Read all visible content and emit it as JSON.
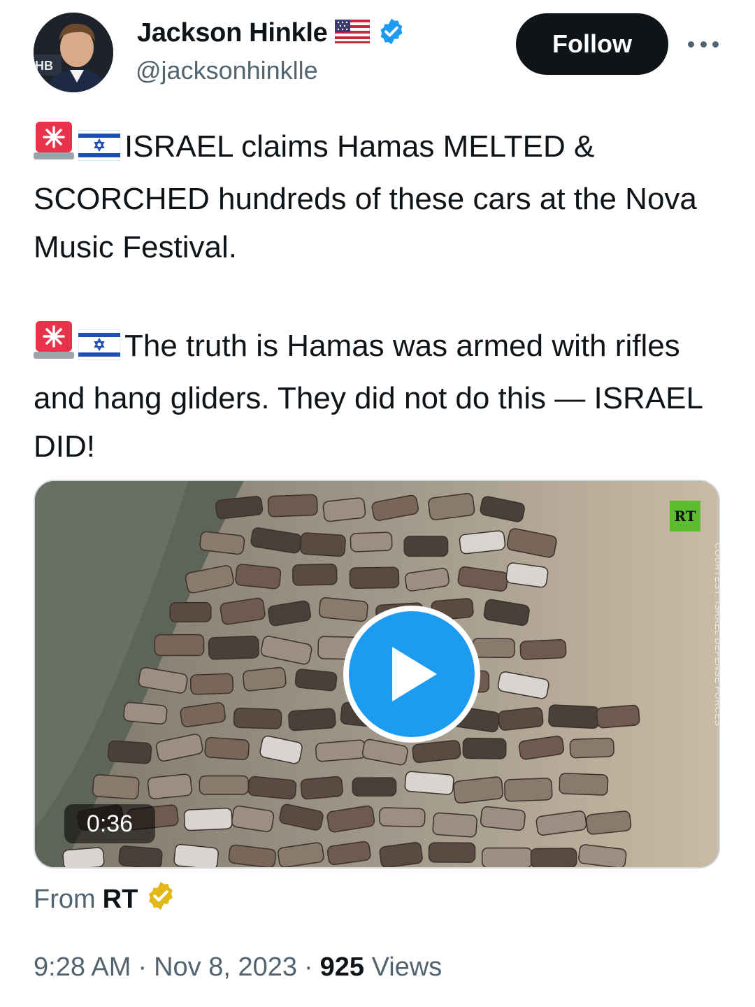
{
  "author": {
    "name": "Jackson Hinkle",
    "handle": "@jacksonhinklle",
    "flag_icon": "us-flag-icon",
    "verified_icon": "blue-verified-badge-icon"
  },
  "actions": {
    "follow_label": "Follow",
    "more_icon": "more-options-icon"
  },
  "tweet": {
    "paragraphs": [
      {
        "icons": [
          "police-light-icon",
          "israel-flag-icon"
        ],
        "text": "ISRAEL claims Hamas MELTED & SCORCHED hundreds of these cars  at the Nova Music Festival."
      },
      {
        "icons": [
          "police-light-icon",
          "israel-flag-icon"
        ],
        "text": "The truth is Hamas was armed with rifles and hang gliders. They did not do this — ISRAEL DID!"
      }
    ]
  },
  "media": {
    "duration": "0:36",
    "watermark_logo": "RT",
    "courtesy": "COURTESY: ISRAEL DEFENSE FORCES",
    "play_icon": "play-icon"
  },
  "source": {
    "prefix": "From",
    "name": "RT",
    "badge_icon": "gold-verified-badge-icon"
  },
  "meta": {
    "time": "9:28 AM",
    "separator": "·",
    "date": "Nov 8, 2023",
    "views_count": "925",
    "views_label": "Views"
  },
  "colors": {
    "accent": "#1d9bf0",
    "text": "#0f1419",
    "secondary": "#536471",
    "follow_bg": "#0f1419",
    "gold_badge": "#e2b719"
  }
}
